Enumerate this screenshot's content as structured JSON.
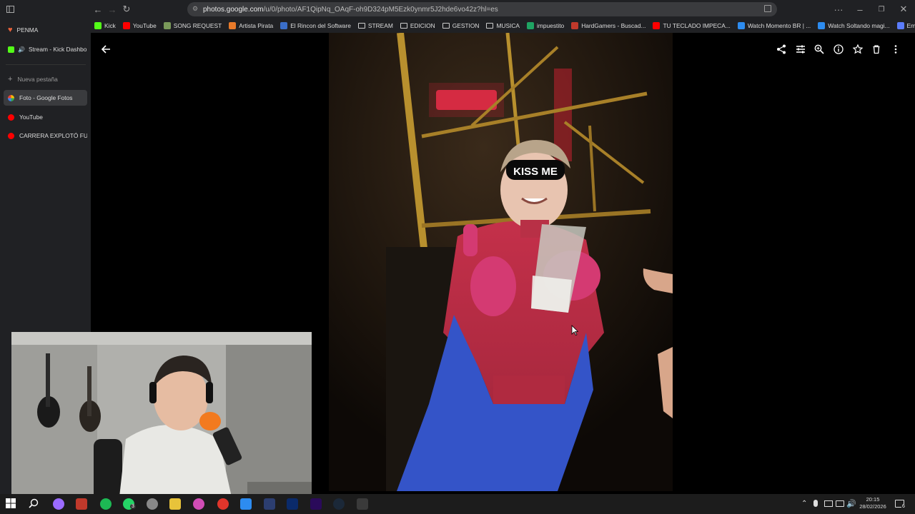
{
  "browser": {
    "url_host": "photos.google.com",
    "url_path": "/u/0/photo/AF1QipNq_OAqF-oh9D324pM5Ezk0ynmr5J2hde6vo42z?hl=es",
    "bookmarks": [
      {
        "label": "Kick",
        "icon": "kick-icon",
        "color": "#53fc18"
      },
      {
        "label": "YouTube",
        "icon": "youtube-icon",
        "color": "#ff0000"
      },
      {
        "label": "SONG REQUEST",
        "icon": "song-request-icon",
        "color": "#7a9a5a"
      },
      {
        "label": "Artista Pirata",
        "icon": "ap-icon",
        "color": "#e87a2a"
      },
      {
        "label": "El Rincon del Software",
        "icon": "software-icon",
        "color": "#3a6ec8"
      },
      {
        "label": "STREAM",
        "icon": "folder-icon",
        "color": "#cccccc"
      },
      {
        "label": "EDICION",
        "icon": "folder-icon",
        "color": "#cccccc"
      },
      {
        "label": "GESTION",
        "icon": "folder-icon",
        "color": "#cccccc"
      },
      {
        "label": "MUSICA",
        "icon": "folder-icon",
        "color": "#cccccc"
      },
      {
        "label": "impuestito",
        "icon": "sheet-icon",
        "color": "#1fa463"
      },
      {
        "label": "HardGamers - Buscad...",
        "icon": "hardgamers-icon",
        "color": "#c0392b"
      },
      {
        "label": "TU TECLADO IMPECA...",
        "icon": "youtube-icon",
        "color": "#ff0000"
      },
      {
        "label": "Watch Momento BR | ...",
        "icon": "watch-icon",
        "color": "#2d8cf0"
      },
      {
        "label": "Watch Soltando magi...",
        "icon": "watch-icon",
        "color": "#2d8cf0"
      },
      {
        "label": "Embed Generator",
        "icon": "embed-icon",
        "color": "#5b7cfa"
      }
    ]
  },
  "sidebar": {
    "items": [
      {
        "label": "PENMA",
        "icon": "heart-icon",
        "color": "#e8623a"
      },
      {
        "label": "Stream - Kick Dashbo",
        "icon": "kick-icon",
        "color": "#53fc18"
      },
      {
        "label": "Nueva pestaña",
        "icon": "plus-icon",
        "color": "#aaaaaa"
      },
      {
        "label": "Foto - Google Fotos",
        "icon": "google-photos-icon",
        "color": "#fbbc05"
      },
      {
        "label": "YouTube",
        "icon": "youtube-icon",
        "color": "#ff0000"
      },
      {
        "label": "CARRERA EXPLOTÓ FUER",
        "icon": "youtube-icon",
        "color": "#ff0000"
      }
    ]
  },
  "photo": {
    "sunglasses_text": "KISS ME"
  },
  "taskbar": {
    "time": "20:15",
    "date": "28/02/2026",
    "notification_count": "6",
    "whatsapp_badge": "3"
  }
}
